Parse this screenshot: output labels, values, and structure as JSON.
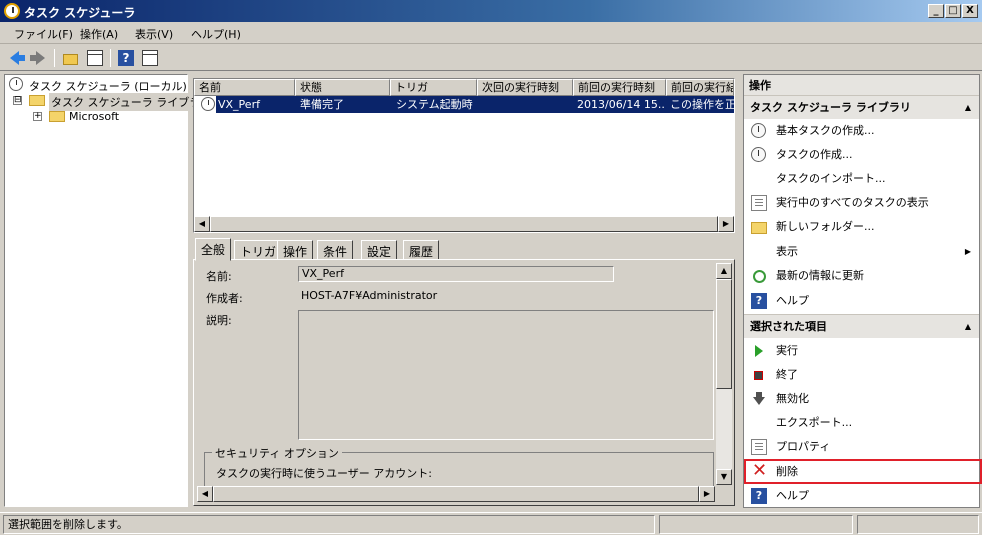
{
  "window": {
    "title": "タスク スケジューラ",
    "buttons": {
      "minimize": "_",
      "maximize": "□",
      "close": "X"
    }
  },
  "menubar": {
    "items": [
      "ファイル(F)",
      "操作(A)",
      "表示(V)",
      "ヘルプ(H)"
    ]
  },
  "toolbar": {
    "icons": [
      "back-icon",
      "forward-icon",
      "up-folder-icon",
      "show-hide-console-tree-icon",
      "help-icon",
      "show-hide-action-pane-icon"
    ]
  },
  "tree": {
    "root": "タスク スケジューラ (ローカル)",
    "library": "タスク スケジューラ ライブラリ",
    "child": "Microsoft",
    "library_expander": "⊟",
    "child_expander": "+"
  },
  "tasklist": {
    "columns": [
      "名前",
      "状態",
      "トリガ",
      "次回の実行時刻",
      "前回の実行時刻",
      "前回の実行結果"
    ],
    "rows": [
      {
        "name": "VX_Perf",
        "status": "準備完了",
        "trigger": "システム起動時",
        "next": "",
        "last": "2013/06/14 15...",
        "result": "この操作を正"
      }
    ]
  },
  "tabs": [
    "全般",
    "トリガ",
    "操作",
    "条件",
    "設定",
    "履歴"
  ],
  "general": {
    "name_label": "名前:",
    "name_value": "VX_Perf",
    "author_label": "作成者:",
    "author_value": "HOST-A7F¥Administrator",
    "description_label": "説明:",
    "security_group": "セキュリティ オプション",
    "run_as_label": "タスクの実行時に使うユーザー アカウント:"
  },
  "actions": {
    "title": "操作",
    "section1": {
      "header": "タスク スケジューラ ライブラリ",
      "items": [
        {
          "label": "基本タスクの作成...",
          "icon": "create-basic-task-icon"
        },
        {
          "label": "タスクの作成...",
          "icon": "create-task-icon"
        },
        {
          "label": "タスクのインポート...",
          "icon": ""
        },
        {
          "label": "実行中のすべてのタスクの表示",
          "icon": "running-tasks-icon"
        },
        {
          "label": "新しいフォルダー...",
          "icon": "new-folder-icon"
        },
        {
          "label": "表示",
          "icon": ""
        },
        {
          "label": "最新の情報に更新",
          "icon": "refresh-icon"
        },
        {
          "label": "ヘルプ",
          "icon": "help-icon"
        }
      ]
    },
    "section2": {
      "header": "選択された項目",
      "items": [
        {
          "label": "実行",
          "icon": "run-icon"
        },
        {
          "label": "終了",
          "icon": "end-icon"
        },
        {
          "label": "無効化",
          "icon": "disable-icon"
        },
        {
          "label": "エクスポート...",
          "icon": ""
        },
        {
          "label": "プロパティ",
          "icon": "properties-icon"
        },
        {
          "label": "削除",
          "icon": "delete-icon"
        },
        {
          "label": "ヘルプ",
          "icon": "help-icon"
        }
      ]
    },
    "highlight_color": "#e0202a"
  },
  "statusbar": {
    "text": "選択範囲を削除します。"
  }
}
